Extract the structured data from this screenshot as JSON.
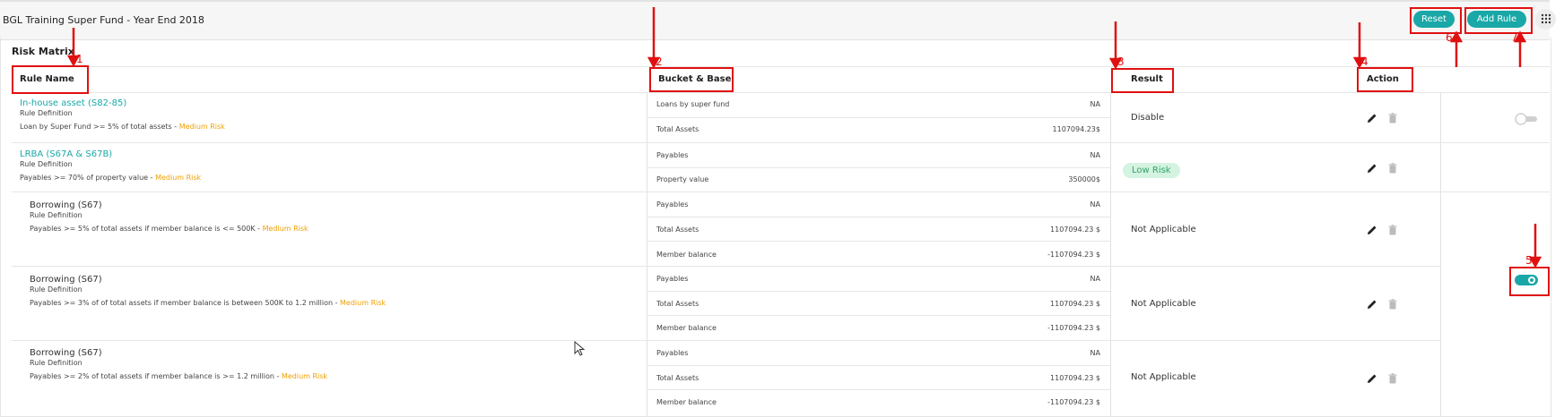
{
  "header": {
    "title": "BGL Training Super Fund - Year End 2018",
    "reset_label": "Reset",
    "add_rule_label": "Add Rule"
  },
  "matrix": {
    "title": "Risk Matrix",
    "columns": {
      "rule_name": "Rule Name",
      "bucket_base": "Bucket & Base",
      "result": "Result",
      "action": "Action"
    },
    "rules": [
      {
        "name": "In-house asset (S82-85)",
        "definition_label": "Rule Definition",
        "definition": "Loan by Super Fund >= 5% of total assets - ",
        "risk": "Medium Risk",
        "result": "Disable",
        "buckets": [
          {
            "label": "Loans by super fund",
            "value": "NA"
          },
          {
            "label": "Total Assets",
            "value": "1107094.23$"
          }
        ]
      },
      {
        "name": "LRBA (S67A & S67B)",
        "definition_label": "Rule Definition",
        "definition": "Payables >= 70% of property value - ",
        "risk": "Medium Risk",
        "result": "Low Risk",
        "buckets": [
          {
            "label": "Payables",
            "value": "NA"
          },
          {
            "label": "Property value",
            "value": "350000$"
          }
        ]
      },
      {
        "name": "Borrowing (S67)",
        "definition_label": "Rule Definition",
        "definition": "Payables >= 5% of total assets if member balance is <= 500K - ",
        "risk": "Medium Risk",
        "result": "Not Applicable",
        "buckets": [
          {
            "label": "Payables",
            "value": "NA"
          },
          {
            "label": "Total Assets",
            "value": "1107094.23 $"
          },
          {
            "label": "Member balance",
            "value": "-1107094.23 $"
          }
        ]
      },
      {
        "name": "Borrowing (S67)",
        "definition_label": "Rule Definition",
        "definition": "Payables >= 3% of of total assets if member balance is between 500K to 1.2 million - ",
        "risk": "Medium Risk",
        "result": "Not Applicable",
        "buckets": [
          {
            "label": "Payables",
            "value": "NA"
          },
          {
            "label": "Total Assets",
            "value": "1107094.23 $"
          },
          {
            "label": "Member balance",
            "value": "-1107094.23 $"
          }
        ]
      },
      {
        "name": "Borrowing (S67)",
        "definition_label": "Rule Definition",
        "definition": "Payables >= 2% of total assets if member balance is >= 1.2 million - ",
        "risk": "Medium Risk",
        "result": "Not Applicable",
        "buckets": [
          {
            "label": "Payables",
            "value": "NA"
          },
          {
            "label": "Total Assets",
            "value": "1107094.23 $"
          },
          {
            "label": "Member balance",
            "value": "-1107094.23 $"
          }
        ]
      }
    ],
    "toggles": [
      {
        "state": "off"
      },
      {
        "state": "on"
      }
    ]
  },
  "annotations": {
    "n1": "1",
    "n2": "2",
    "n3": "3",
    "n4": "4",
    "n5": "5",
    "n6": "6",
    "n7": "7"
  },
  "colors": {
    "accent": "#1aa7a7",
    "annotation": "#e01010",
    "medium_risk": "#f0a000",
    "low_risk_bg": "#d4f3e1"
  }
}
